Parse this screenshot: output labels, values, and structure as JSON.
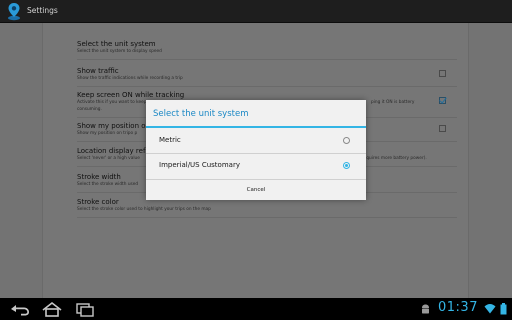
{
  "app": {
    "title": "Settings",
    "icon": "location-pin-icon"
  },
  "preferences": [
    {
      "title": "Select the unit system",
      "summary": "Select the unit system to display speed",
      "checkbox": null
    },
    {
      "title": "Show traffic",
      "summary": "Show the traffic indications while recording a trip",
      "checkbox": false
    },
    {
      "title": "Keep screen ON while tracking",
      "summary_line1": "Activate this if you want to keep",
      "summary_line1_end": "ping it ON is battery",
      "summary_line2": "consuming.",
      "checkbox": true
    },
    {
      "title": "Show my position on",
      "summary": "Show my position on tripo p",
      "checkbox": false
    },
    {
      "title": "Location display refre",
      "summary": "Select 'never' or a high value",
      "summary_end": "requires more battery power).",
      "checkbox": null
    },
    {
      "title": "Stroke width",
      "summary": "Select the stroke width used",
      "checkbox": null
    },
    {
      "title": "Stroke color",
      "summary": "Select the stroke color used to highlight your trips on the map",
      "checkbox": null
    }
  ],
  "dialog": {
    "title": "Select the unit system",
    "options": [
      {
        "label": "Metric",
        "selected": false
      },
      {
        "label": "Imperial/US Customary",
        "selected": true
      }
    ],
    "cancel_label": "Cancel"
  },
  "system_bar": {
    "time": "01:37",
    "icons": [
      "back-icon",
      "home-icon",
      "recent-apps-icon",
      "android-icon",
      "wifi-icon",
      "battery-icon"
    ]
  },
  "colors": {
    "accent": "#33b5e5",
    "dialog_bg": "#f1f1f1",
    "dim_bg": "#737373",
    "action_bar": "#1e1e1e"
  }
}
